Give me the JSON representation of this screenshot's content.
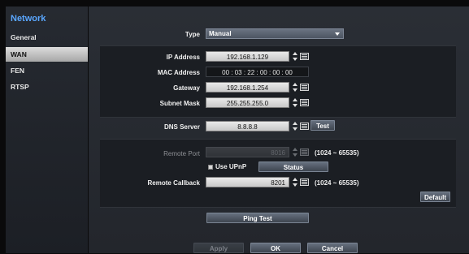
{
  "sidebar": {
    "title": "Network",
    "items": [
      "General",
      "WAN",
      "FEN",
      "RTSP"
    ],
    "selected": "WAN"
  },
  "type": {
    "label": "Type",
    "value": "Manual"
  },
  "ip": {
    "ip_label": "IP Address",
    "ip_value": "192.168.1.129",
    "mac_label": "MAC Address",
    "mac_value": "00 : 03 : 22 : 00 : 00 : 00",
    "gw_label": "Gateway",
    "gw_value": "192.168.1.254",
    "mask_label": "Subnet Mask",
    "mask_value": "255.255.255.0"
  },
  "dns": {
    "label": "DNS Server",
    "value": "8.8.8.8",
    "test_label": "Test"
  },
  "remote": {
    "port_label": "Remote Port",
    "port_value": "8016",
    "port_range": "(1024 ~ 65535)",
    "upnp_label": "Use UPnP",
    "upnp_checked": true,
    "status_label": "Status",
    "callback_label": "Remote Callback",
    "callback_value": "8201",
    "callback_range": "(1024 ~ 65535)",
    "default_label": "Default"
  },
  "actions": {
    "ping_label": "Ping Test",
    "apply_label": "Apply",
    "ok_label": "OK",
    "cancel_label": "Cancel"
  }
}
